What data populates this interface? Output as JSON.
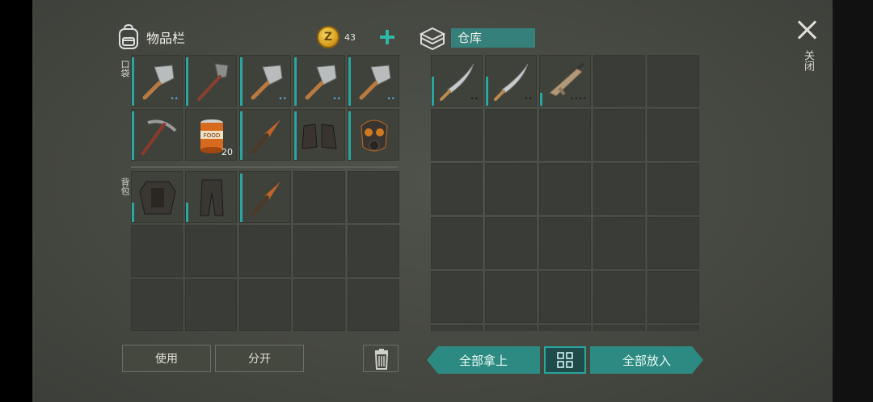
{
  "inventory": {
    "title": "物品栏",
    "coins": "43",
    "pocket_label": "口袋",
    "backpack_label": "背包"
  },
  "pocket_slots": [
    {
      "item": "cleaver-icon",
      "dots": "••"
    },
    {
      "item": "shovel-icon",
      "dots": ""
    },
    {
      "item": "cleaver-icon",
      "dots": "••"
    },
    {
      "item": "cleaver-icon",
      "dots": "••"
    },
    {
      "item": "cleaver-icon",
      "dots": "••"
    },
    {
      "item": "pickaxe-icon",
      "dots": ""
    },
    {
      "item": "canned-food-icon",
      "qty": "20",
      "can_label": "FOOD"
    },
    {
      "item": "spiked-club-icon",
      "dots": ""
    },
    {
      "item": "boots-icon",
      "dots": ""
    },
    {
      "item": "gas-mask-icon",
      "dots": ""
    }
  ],
  "backpack_slots": [
    {
      "item": "body-armor-icon"
    },
    {
      "item": "armored-pants-icon"
    },
    {
      "item": "spiked-club-icon"
    }
  ],
  "warehouse": {
    "title": "仓库"
  },
  "warehouse_slots": [
    {
      "item": "machete-icon",
      "dots": "••"
    },
    {
      "item": "machete-icon",
      "dots": "••"
    },
    {
      "item": "rifle-icon",
      "dots": "••••"
    }
  ],
  "actions": {
    "use": "使用",
    "split": "分开",
    "take_all": "全部拿上",
    "put_all": "全部放入",
    "close": "关闭"
  },
  "colors": {
    "accent": "#2aa69a",
    "slot_bg": "#3a3d37",
    "panel_bg": "#4a4d46",
    "coin": "#e0b030"
  }
}
